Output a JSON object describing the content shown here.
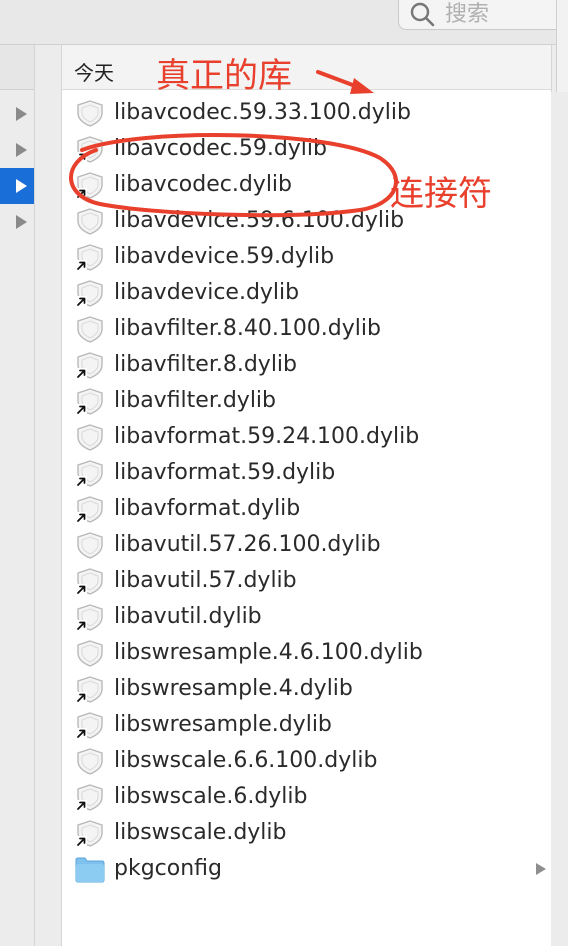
{
  "search": {
    "placeholder": "搜索"
  },
  "column": {
    "header": "今天"
  },
  "sidebar_rows": [
    {
      "selected": false
    },
    {
      "selected": false
    },
    {
      "selected": true
    },
    {
      "selected": false
    }
  ],
  "files": [
    {
      "name": "libavcodec.59.33.100.dylib",
      "alias": false
    },
    {
      "name": "libavcodec.59.dylib",
      "alias": true
    },
    {
      "name": "libavcodec.dylib",
      "alias": true
    },
    {
      "name": "libavdevice.59.6.100.dylib",
      "alias": false
    },
    {
      "name": "libavdevice.59.dylib",
      "alias": true
    },
    {
      "name": "libavdevice.dylib",
      "alias": true
    },
    {
      "name": "libavfilter.8.40.100.dylib",
      "alias": false
    },
    {
      "name": "libavfilter.8.dylib",
      "alias": true
    },
    {
      "name": "libavfilter.dylib",
      "alias": true
    },
    {
      "name": "libavformat.59.24.100.dylib",
      "alias": false
    },
    {
      "name": "libavformat.59.dylib",
      "alias": true
    },
    {
      "name": "libavformat.dylib",
      "alias": true
    },
    {
      "name": "libavutil.57.26.100.dylib",
      "alias": false
    },
    {
      "name": "libavutil.57.dylib",
      "alias": true
    },
    {
      "name": "libavutil.dylib",
      "alias": true
    },
    {
      "name": "libswresample.4.6.100.dylib",
      "alias": false
    },
    {
      "name": "libswresample.4.dylib",
      "alias": true
    },
    {
      "name": "libswresample.dylib",
      "alias": true
    },
    {
      "name": "libswscale.6.6.100.dylib",
      "alias": false
    },
    {
      "name": "libswscale.6.dylib",
      "alias": true
    },
    {
      "name": "libswscale.dylib",
      "alias": true
    },
    {
      "name": "pkgconfig",
      "alias": false,
      "folder": true
    }
  ],
  "annotations": {
    "real_library": "真正的库",
    "symlink": "连接符",
    "color": "#e8402c"
  }
}
